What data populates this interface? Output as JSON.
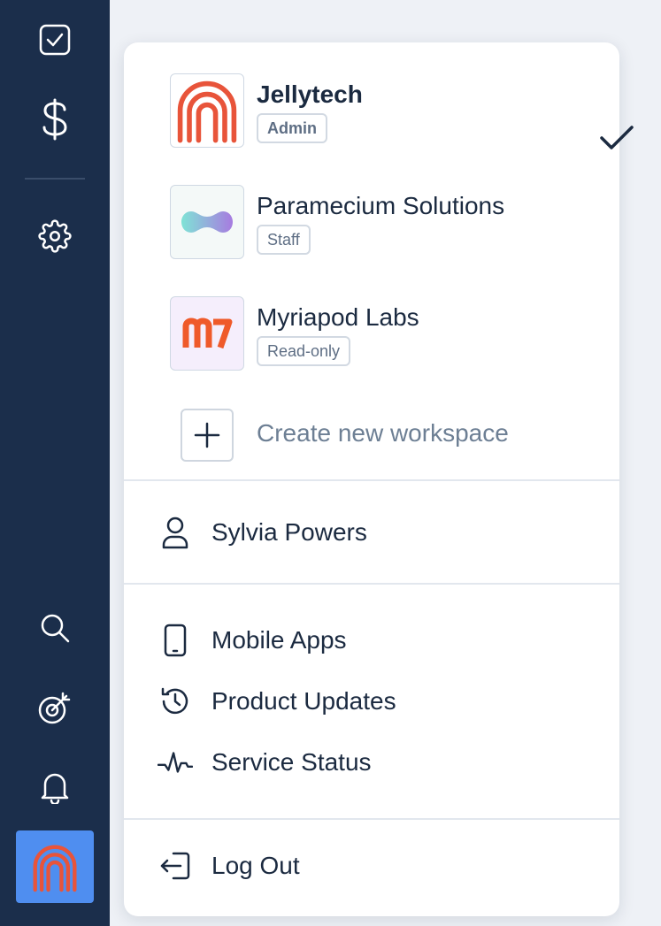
{
  "sidebar": {
    "icons": [
      "checkbox-icon",
      "dollar-icon",
      "gear-icon",
      "search-icon",
      "target-icon",
      "bell-icon"
    ],
    "avatar_icon": "fingerprint-logo"
  },
  "workspaces": [
    {
      "name": "Jellytech",
      "role": "Admin",
      "selected": true,
      "logo": "fingerprint-logo"
    },
    {
      "name": "Paramecium Solutions",
      "role": "Staff",
      "selected": false,
      "logo": "blob-logo"
    },
    {
      "name": "Myriapod Labs",
      "role": "Read-only",
      "selected": false,
      "logo": "m7-logo"
    }
  ],
  "create_workspace_label": "Create new workspace",
  "user": {
    "name": "Sylvia Powers"
  },
  "links": {
    "mobile_apps": "Mobile Apps",
    "product_updates": "Product Updates",
    "service_status": "Service Status"
  },
  "logout_label": "Log Out",
  "colors": {
    "sidebar_bg": "#1b2e4b",
    "avatar_bg": "#4f8ef0",
    "brand_orange": "#e8543a",
    "text_dark": "#1b2a40",
    "text_muted": "#6d7f94"
  }
}
